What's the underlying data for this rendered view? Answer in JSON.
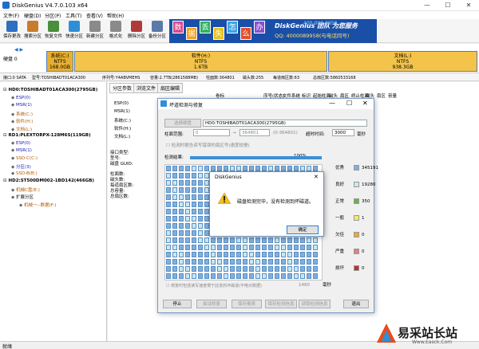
{
  "window": {
    "title": "DiskGenius V4.7.0.103 x64",
    "min": "—",
    "max": "☐",
    "close": "✕"
  },
  "menu": [
    "文件(F)",
    "硬盘(D)",
    "分区(P)",
    "工具(T)",
    "查看(V)",
    "帮助(H)"
  ],
  "toolbar": [
    {
      "label": "保存更改",
      "color": "#2e6fbf",
      "icon": "save-icon"
    },
    {
      "label": "搜索分区",
      "color": "#c97b2d",
      "icon": "search-icon"
    },
    {
      "label": "恢复文件",
      "color": "#4a8f3a",
      "icon": "recover-icon"
    },
    {
      "label": "快速分区",
      "color": "#2f8fd6",
      "icon": "quick-partition-icon"
    },
    {
      "label": "新建分区",
      "color": "#8a8a8a",
      "icon": "new-partition-icon"
    },
    {
      "label": "格式化",
      "color": "#8a8a8a",
      "icon": "format-icon"
    },
    {
      "label": "删除分区",
      "color": "#b03a3a",
      "icon": "delete-partition-icon"
    },
    {
      "label": "备份分区",
      "color": "#5a7aa8",
      "icon": "backup-icon"
    }
  ],
  "banner": {
    "tiles": [
      {
        "t": "数",
        "c": "#d94a8c"
      },
      {
        "t": "据",
        "c": "#f0a020"
      },
      {
        "t": "丢",
        "c": "#2fb35a"
      },
      {
        "t": "失",
        "c": "#e6c220"
      },
      {
        "t": "怎",
        "c": "#3aa3e8"
      },
      {
        "t": "么",
        "c": "#e05030"
      },
      {
        "t": "办",
        "c": "#8a4fcf"
      }
    ],
    "brand": "DiskGenius 团队 为您服务",
    "phone": "QQ: 4000089958(与电话同号)",
    "number": "400-008-9958"
  },
  "disk": {
    "label": "硬盘 0",
    "partitions": [
      {
        "name": "系统(C:)",
        "fs": "NTFS",
        "size": "168.0GB",
        "color": "#e8b030"
      },
      {
        "name": "软件(H:)",
        "fs": "NTFS",
        "size": "1.6TB",
        "color": "#f4c44a"
      },
      {
        "name": "文档(L:)",
        "fs": "NTFS",
        "size": "938.3GB",
        "color": "#f4c44a"
      }
    ]
  },
  "infobar": {
    "iface": "接口:0  SATA",
    "model": "型号:TOSHIBADT01ACA300",
    "serial": "序列号:Y4ABVMEHS",
    "capacity": "容量:2.7TB(2861588MB)",
    "cyl": "柱面数:364801",
    "heads": "磁头数:255",
    "spt": "每道扇区数:63",
    "total": "总扇区数:5860533168"
  },
  "tree": [
    {
      "t": "HD0:TOSHIBADT01ACA300(2795GB)",
      "c": "#000",
      "indent": 0
    },
    {
      "t": "ESP(0)",
      "c": "#1a1ab0",
      "indent": 1
    },
    {
      "t": "MSR(1)",
      "c": "#1a1ab0",
      "indent": 1
    },
    {
      "t": "系统(C:)",
      "c": "#b05a00",
      "indent": 1
    },
    {
      "t": "软件(H:)",
      "c": "#b05a00",
      "indent": 1
    },
    {
      "t": "文档(L:)",
      "c": "#b05a00",
      "indent": 1
    },
    {
      "t": "RD1:PLEXTORPX-128M6S(119GB)",
      "c": "#000",
      "indent": 0
    },
    {
      "t": "ESP(0)",
      "c": "#1a1ab0",
      "indent": 1
    },
    {
      "t": "MSR(1)",
      "c": "#1a1ab0",
      "indent": 1
    },
    {
      "t": "SSD-C(C:)",
      "c": "#b05a00",
      "indent": 1
    },
    {
      "t": "分区(3)",
      "c": "#1a1ab0",
      "indent": 1
    },
    {
      "t": "SSD-B(B:)",
      "c": "#b05a00",
      "indent": 1
    },
    {
      "t": "HD2:ST500DM002-1BD142(466GB)",
      "c": "#000",
      "indent": 0
    },
    {
      "t": "机械C盘(E:)",
      "c": "#b05a00",
      "indent": 1
    },
    {
      "t": "扩展分区",
      "c": "#000",
      "indent": 1
    },
    {
      "t": "机械一--数据(F:)",
      "c": "#b05a00",
      "indent": 2
    }
  ],
  "tabs": [
    "分区参数",
    "浏览文件",
    "扇区编辑"
  ],
  "panel": {
    "header": [
      "卷标",
      "序号(状态)",
      "文件系统",
      "标识",
      "起始柱面",
      "磁头",
      "扇区",
      "终止柱面",
      "磁头",
      "扇区",
      "容量"
    ],
    "rows": [
      "ESP(0)",
      "MSR(1)",
      "系统(C:)",
      "软件(H:)",
      "文档(L:)"
    ],
    "lower": [
      "接口类型:",
      "型号:",
      "磁盘 GUID:",
      "柱面数:",
      "磁头数:",
      "每道扇区数:",
      "总容量:",
      "总扇区数:"
    ]
  },
  "dialog": {
    "title": "坏道检测与修复",
    "select_disk": "选择硬盘",
    "disk_value": "HD0:TOSHIBADT01ACA300(2795GB)",
    "range_label": "柱面范围:",
    "range_from": "0",
    "range_to": "364801",
    "range_hint": "(0-364801)",
    "timeout_label": "超时时间:",
    "timeout_value": "3000",
    "timeout_unit": "毫秒",
    "check_label": "检测时报告读写错误的扇区号(速度较慢)",
    "result_label": "检测结果:",
    "percent": "100%",
    "progress": 1.0,
    "legend": [
      {
        "name": "优秀",
        "color": "#7fb0e0",
        "count": "345191"
      },
      {
        "name": "良好",
        "color": "#c8e8f0",
        "count": "19280"
      },
      {
        "name": "正常",
        "color": "#6ab04c",
        "count": "350"
      },
      {
        "name": "一般",
        "color": "#f5e96a",
        "count": "1"
      },
      {
        "name": "欠佳",
        "color": "#f0a830",
        "count": "0"
      },
      {
        "name": "严重",
        "color": "#e08080",
        "count": "0"
      },
      {
        "name": "损坏",
        "color": "#c03030",
        "count": "0"
      }
    ],
    "repair_label": "修复时包括读写速度慢于此变的坏磁道(不绝对数据)",
    "repair_value": "1480",
    "repair_unit": "毫秒",
    "buttons": [
      {
        "label": "停止",
        "dis": false
      },
      {
        "label": "尝试修复",
        "dis": true
      },
      {
        "label": "保存报表",
        "dis": true
      },
      {
        "label": "保存检测信息",
        "dis": true
      },
      {
        "label": "读取检测信息",
        "dis": true
      },
      {
        "label": "退出",
        "dis": false
      }
    ]
  },
  "message": {
    "title": "DiskGenius",
    "text": "磁盘检测完毕，没有检测到坏磁道。",
    "ok": "确定"
  },
  "status": "就绪",
  "watermark": {
    "text": "易采站长站",
    "sub": "Www.Easck.Com"
  }
}
